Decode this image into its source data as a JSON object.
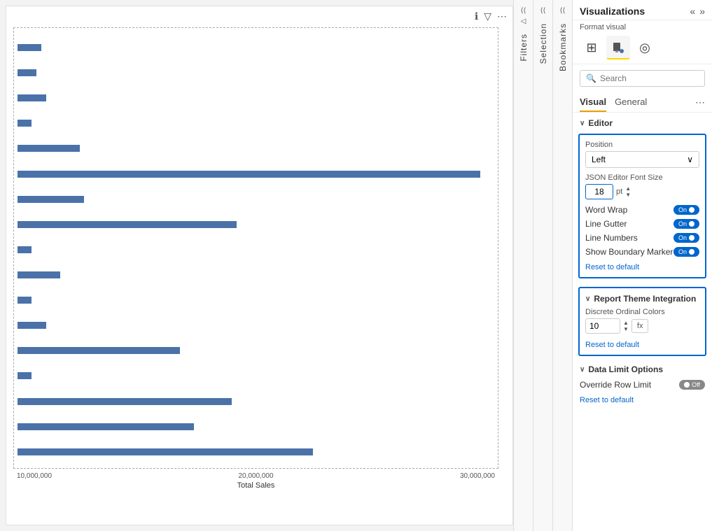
{
  "chart": {
    "top_icons": [
      "ℹ",
      "▽",
      "⋯"
    ],
    "x_axis_labels": [
      "10,000,000",
      "20,000,000",
      "30,000,000"
    ],
    "x_axis_label": "Total Sales",
    "bars": [
      {
        "width_pct": 5
      },
      {
        "width_pct": 4
      },
      {
        "width_pct": 6
      },
      {
        "width_pct": 3
      },
      {
        "width_pct": 13
      },
      {
        "width_pct": 97
      },
      {
        "width_pct": 14
      },
      {
        "width_pct": 46
      },
      {
        "width_pct": 3
      },
      {
        "width_pct": 9
      },
      {
        "width_pct": 3
      },
      {
        "width_pct": 6
      },
      {
        "width_pct": 34
      },
      {
        "width_pct": 3
      },
      {
        "width_pct": 45
      },
      {
        "width_pct": 37
      },
      {
        "width_pct": 62
      }
    ]
  },
  "side_panels": {
    "filters": "Filters",
    "selection": "Selection",
    "bookmarks": "Bookmarks"
  },
  "viz": {
    "title": "Visualizations",
    "header_icons": [
      "«",
      "»"
    ],
    "format_visual_label": "Format visual",
    "icons": [
      {
        "label": "⊞",
        "active": false,
        "name": "grid-icon"
      },
      {
        "label": "↓",
        "active": true,
        "name": "format-icon"
      },
      {
        "label": "◎",
        "active": false,
        "name": "analytics-icon"
      }
    ],
    "search_placeholder": "Search",
    "tabs": [
      {
        "label": "Visual",
        "active": true
      },
      {
        "label": "General",
        "active": false
      }
    ],
    "tab_more": "⋯",
    "editor_section": {
      "title": "Editor",
      "position_label": "Position",
      "position_value": "Left",
      "font_size_label": "JSON Editor Font Size",
      "font_size_value": "18",
      "font_size_unit": "pt",
      "toggles": [
        {
          "label": "Word Wrap",
          "state": "On"
        },
        {
          "label": "Line Gutter",
          "state": "On"
        },
        {
          "label": "Line Numbers",
          "state": "On"
        },
        {
          "label": "Show Boundary Marker",
          "state": "On"
        }
      ],
      "reset_label": "Reset to default"
    },
    "rpt_section": {
      "title": "Report Theme Integration",
      "discrete_label": "Discrete Ordinal Colors",
      "discrete_value": "10",
      "fx_label": "fx",
      "reset_label": "Reset to default"
    },
    "data_limit_section": {
      "title": "Data Limit Options",
      "override_label": "Override Row Limit",
      "override_state": "Off",
      "reset_label": "Reset to default"
    }
  }
}
